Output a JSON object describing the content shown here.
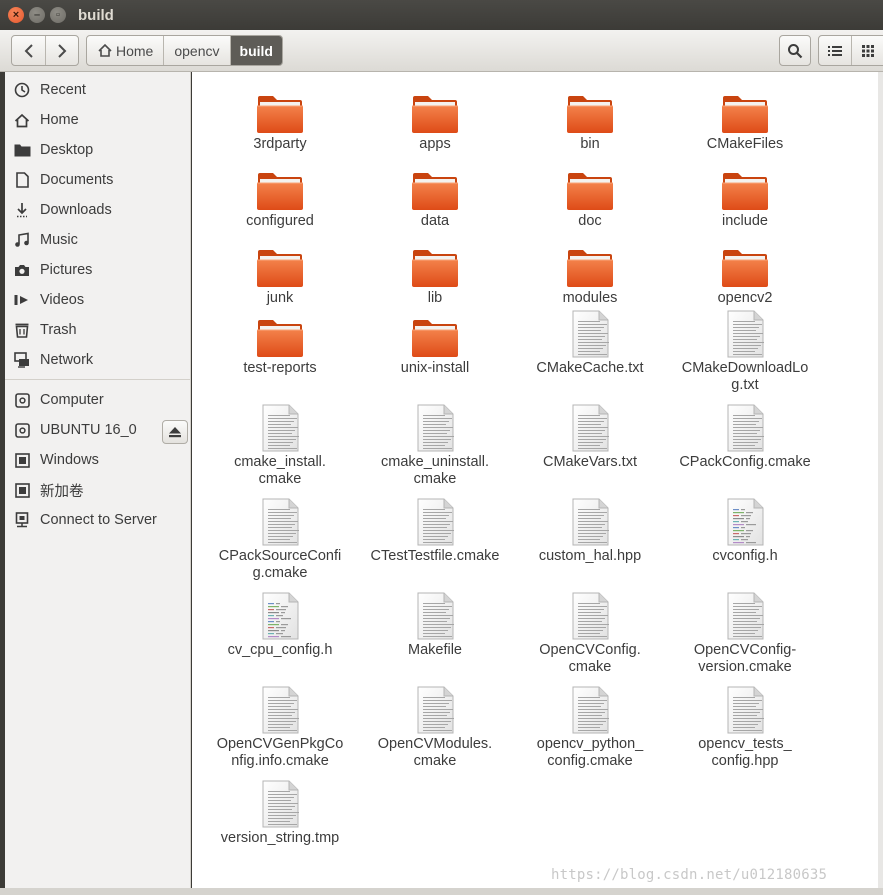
{
  "window": {
    "title": "build"
  },
  "toolbar": {
    "breadcrumbs": [
      "Home",
      "opencv",
      "build"
    ]
  },
  "sidebar": {
    "places": [
      {
        "label": "Recent",
        "icon": "clock-icon"
      },
      {
        "label": "Home",
        "icon": "home-icon"
      },
      {
        "label": "Desktop",
        "icon": "folder-icon"
      },
      {
        "label": "Documents",
        "icon": "document-icon"
      },
      {
        "label": "Downloads",
        "icon": "download-icon"
      },
      {
        "label": "Music",
        "icon": "music-icon"
      },
      {
        "label": "Pictures",
        "icon": "camera-icon"
      },
      {
        "label": "Videos",
        "icon": "video-icon"
      },
      {
        "label": "Trash",
        "icon": "trash-icon"
      },
      {
        "label": "Network",
        "icon": "network-icon"
      }
    ],
    "devices": [
      {
        "label": "Computer",
        "icon": "drive-icon"
      },
      {
        "label": "UBUNTU 16_0",
        "icon": "drive-icon"
      },
      {
        "label": "Windows",
        "icon": "chip-icon"
      },
      {
        "label": "新加卷",
        "icon": "chip-icon"
      },
      {
        "label": "Connect to Server",
        "icon": "server-icon"
      }
    ]
  },
  "files": [
    {
      "name": "3rdparty",
      "kind": "folder"
    },
    {
      "name": "apps",
      "kind": "folder"
    },
    {
      "name": "bin",
      "kind": "folder"
    },
    {
      "name": "CMakeFiles",
      "kind": "folder"
    },
    {
      "name": "configured",
      "kind": "folder"
    },
    {
      "name": "data",
      "kind": "folder"
    },
    {
      "name": "doc",
      "kind": "folder"
    },
    {
      "name": "include",
      "kind": "folder"
    },
    {
      "name": "junk",
      "kind": "folder"
    },
    {
      "name": "lib",
      "kind": "folder"
    },
    {
      "name": "modules",
      "kind": "folder"
    },
    {
      "name": "opencv2",
      "kind": "folder"
    },
    {
      "name": "test-reports",
      "kind": "folder"
    },
    {
      "name": "unix-install",
      "kind": "folder"
    },
    {
      "name": "CMakeCache.txt",
      "kind": "text"
    },
    {
      "name": "CMakeDownloadLo\ng.txt",
      "kind": "text"
    },
    {
      "name": "cmake_install.\ncmake",
      "kind": "text"
    },
    {
      "name": "cmake_uninstall.\ncmake",
      "kind": "text"
    },
    {
      "name": "CMakeVars.txt",
      "kind": "text"
    },
    {
      "name": "CPackConfig.cmake",
      "kind": "text"
    },
    {
      "name": "CPackSourceConfi\ng.cmake",
      "kind": "text"
    },
    {
      "name": "CTestTestfile.cmake",
      "kind": "text"
    },
    {
      "name": "custom_hal.hpp",
      "kind": "text"
    },
    {
      "name": "cvconfig.h",
      "kind": "code"
    },
    {
      "name": "cv_cpu_config.h",
      "kind": "code"
    },
    {
      "name": "Makefile",
      "kind": "text"
    },
    {
      "name": "OpenCVConfig.\ncmake",
      "kind": "text"
    },
    {
      "name": "OpenCVConfig-\nversion.cmake",
      "kind": "text"
    },
    {
      "name": "OpenCVGenPkgCo\nnfig.info.cmake",
      "kind": "text"
    },
    {
      "name": "OpenCVModules.\ncmake",
      "kind": "text"
    },
    {
      "name": "opencv_python_\nconfig.cmake",
      "kind": "text"
    },
    {
      "name": "opencv_tests_\nconfig.hpp",
      "kind": "text"
    },
    {
      "name": "version_string.tmp",
      "kind": "text"
    }
  ],
  "watermark": "https://blog.csdn.net/u012180635"
}
